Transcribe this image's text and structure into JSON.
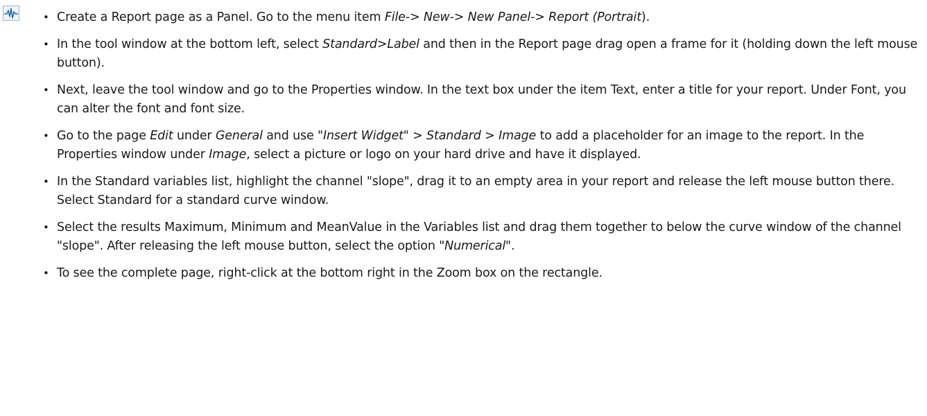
{
  "icon": "signal-waveform-icon",
  "colors": {
    "text": "#1a1a1a",
    "icon_border": "#9fb6cc",
    "icon_wave": "#2b6cb0"
  },
  "bullet_glyph": "•",
  "items": [
    {
      "segments": [
        {
          "t": "Create a Report page as a Panel. Go to the menu item "
        },
        {
          "t": "File-> New-> New Panel-> Report (Portrait",
          "i": true
        },
        {
          "t": ")."
        }
      ]
    },
    {
      "segments": [
        {
          "t": "In the tool window at the bottom left, select "
        },
        {
          "t": "Standard>Label",
          "i": true
        },
        {
          "t": " and then in the Report page drag open a frame for it (holding down the left mouse button)."
        }
      ]
    },
    {
      "segments": [
        {
          "t": "Next, leave the tool window and go to the Properties window. In the text box under the item Text, enter a title for your report. Under Font, you can alter the font and font size."
        }
      ]
    },
    {
      "segments": [
        {
          "t": "Go to the page "
        },
        {
          "t": "Edit",
          "i": true
        },
        {
          "t": " under "
        },
        {
          "t": "General",
          "i": true
        },
        {
          "t": " and use \""
        },
        {
          "t": "Insert Widget",
          "i": true
        },
        {
          "t": "\" > "
        },
        {
          "t": "Standard > Image",
          "i": true
        },
        {
          "t": " to add a placeholder for an image to the report. In the Properties window under "
        },
        {
          "t": "Image",
          "i": true
        },
        {
          "t": ", select a picture or logo on your hard drive and have it displayed."
        }
      ]
    },
    {
      "segments": [
        {
          "t": "In the Standard variables list, highlight the channel \"slope\", drag it to an empty area in your report and release the left mouse button there. Select Standard for a standard curve window."
        }
      ]
    },
    {
      "segments": [
        {
          "t": "Select the results Maximum, Minimum and MeanValue in the Variables list and drag them together to below the curve window of the channel \"slope\". After releasing the left mouse button, select the option \""
        },
        {
          "t": "Numerical",
          "i": true
        },
        {
          "t": "\"."
        }
      ]
    },
    {
      "segments": [
        {
          "t": "To see the complete page, right-click at the bottom right in the Zoom box on the rectangle."
        }
      ]
    }
  ]
}
